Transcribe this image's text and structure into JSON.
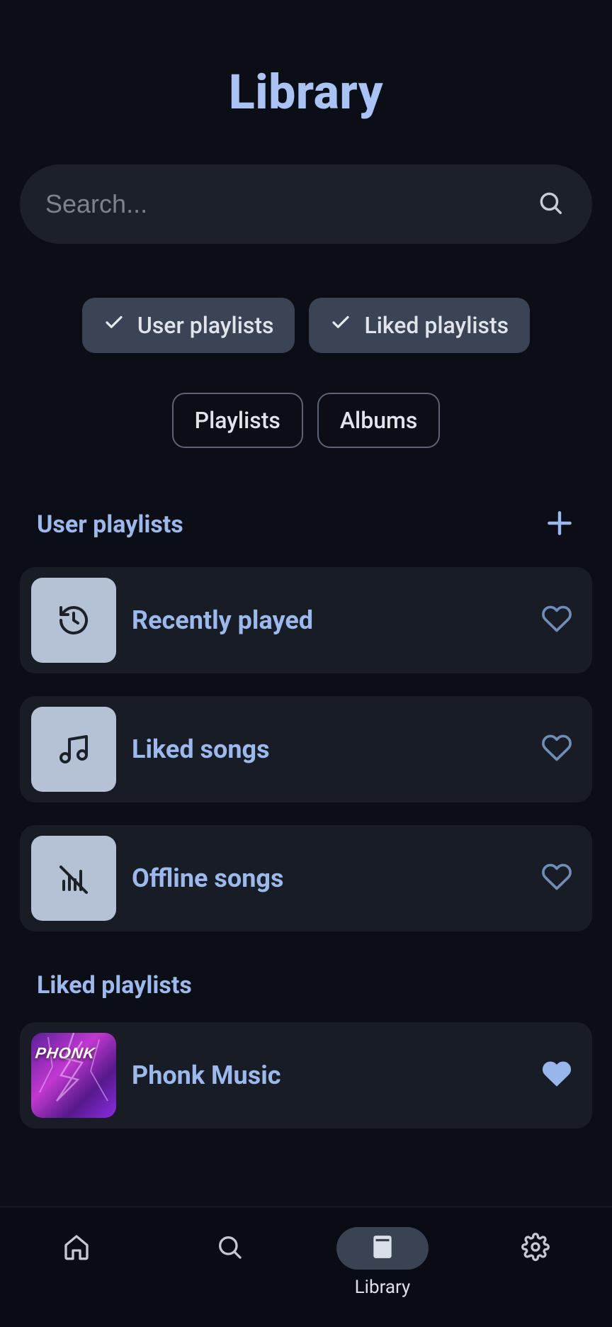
{
  "header": {
    "title": "Library"
  },
  "search": {
    "placeholder": "Search..."
  },
  "filters": {
    "user_playlists": "User playlists",
    "liked_playlists": "Liked playlists",
    "playlists": "Playlists",
    "albums": "Albums"
  },
  "sections": {
    "user_playlists": {
      "title": "User playlists",
      "items": [
        {
          "title": "Recently played",
          "icon": "history-icon",
          "liked": false
        },
        {
          "title": "Liked songs",
          "icon": "music-note-icon",
          "liked": false
        },
        {
          "title": "Offline songs",
          "icon": "offline-icon",
          "liked": false
        }
      ]
    },
    "liked_playlists": {
      "title": "Liked playlists",
      "items": [
        {
          "title": "Phonk Music",
          "art_label": "PHONK",
          "liked": true
        }
      ]
    }
  },
  "nav": {
    "home": "Home",
    "search": "Search",
    "library": "Library",
    "settings": "Settings",
    "active": "library"
  },
  "colors": {
    "bg": "#0b0e14",
    "card": "#171c25",
    "chip": "#3b4454",
    "accent": "#9bb9ec"
  }
}
